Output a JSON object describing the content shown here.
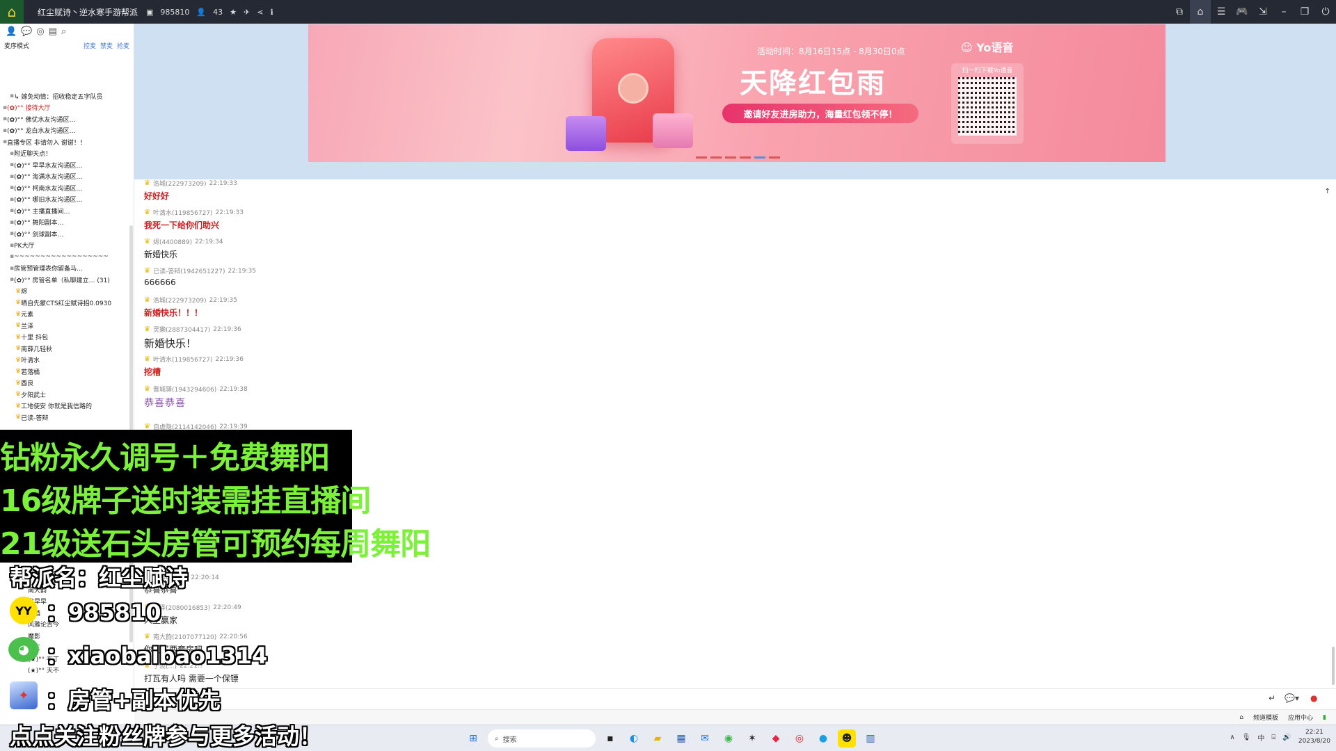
{
  "titlebar": {
    "title": "红尘赋诗丶逆水寒手游帮派",
    "channel_id": "985810",
    "user_count": "43"
  },
  "sidebar": {
    "mode": "麦序模式",
    "links": [
      "控麦",
      "禁麦",
      "抢麦"
    ],
    "tree": [
      "↳ 嫁免动情：招收稳定五字队员",
      "(✿)°° 接待大厅",
      "(✿)°° 佛优水友沟通区…",
      "(✿)°° 龙白水友沟通区…",
      "直播专区  非请勿入  谢谢！！",
      "附近聊天点！",
      "(✿)°° 早早水友沟通区…",
      "(✿)°° 淘满水友沟通区…",
      "(✿)°° 柯南水友沟通区…",
      "(✿)°° 哪旧水友沟通区…",
      "(✿)°° 主播直播间…",
      "(✿)°° 舞阳副本…",
      "(✿)°° 剑球副本…",
      "PK大厅",
      "~~~~~~~~~~~~~~~~~~",
      "房管预管理表你留备马…",
      "(✿)°° 房管名单（私聊建立…  (31)",
      "烬",
      "晒自先蒙CTS红尘赋诗招0.0930",
      "元素",
      "兰泽",
      "十里 抖包",
      "南薛几轻秋",
      "叶清水",
      "若落橘",
      "酉良",
      "夕阳武士",
      "工地使安  你就是我信路的",
      "已读-答辩"
    ],
    "tree_lower": [
      "南大韵",
      "龙早早",
      "早酒",
      "风雅论吉今",
      "魔影",
      "黯三",
      "(★)°° 布丁",
      "(★)°° 天不"
    ]
  },
  "banner": {
    "time": "活动时间：8月16日15点 - 8月30日0点",
    "headline": "天降红包雨",
    "slogan": "邀请好友进房助力，海量红包领不停！",
    "brand": "Yo语音",
    "qr_label": "扫一扫下载Yo语音"
  },
  "chat": [
    {
      "user": "浩城(222973209)",
      "time": "22:19:33",
      "text": "好好好",
      "style": "red"
    },
    {
      "user": "叶清水(119856727)",
      "time": "22:19:33",
      "text": "我死一下给你们助兴",
      "style": "red"
    },
    {
      "user": "烬(4400889)",
      "time": "22:19:34",
      "text": "新婚快乐",
      "style": "plain"
    },
    {
      "user": "已读-答辩(1942651227)",
      "time": "22:19:35",
      "text": "666666",
      "style": "plain"
    },
    {
      "user": "浩城(222973209)",
      "time": "22:19:35",
      "text": "新婚快乐！！！",
      "style": "red"
    },
    {
      "user": "灵獭(2887304417)",
      "time": "22:19:36",
      "text": "新婚快乐！",
      "style": "big"
    },
    {
      "user": "叶清水(119856727)",
      "time": "22:19:36",
      "text": "挖槽",
      "style": "red"
    },
    {
      "user": "晋城驿(1943294606)",
      "time": "22:19:38",
      "text": "恭喜恭喜",
      "style": "purple"
    },
    {
      "user": "自虐隐(2114142046)",
      "time": "22:19:39",
      "text": "",
      "style": "plain"
    },
    {
      "user": "(…382841)",
      "time": "22:20:14",
      "text": "恭喜恭喜",
      "style": "plain"
    },
    {
      "user": "兰泽(2080016853)",
      "time": "22:20:49",
      "text": "人生赢家",
      "style": "plain"
    },
    {
      "user": "南大韵(2107077120)",
      "time": "22:20:56",
      "text": "你们买两套房吧",
      "style": "plain"
    },
    {
      "user": "子规(…)",
      "time": "22:21:?",
      "text": "打瓦有人吗  需要一个保镖",
      "style": "plain"
    }
  ],
  "statusbar": {
    "items": [
      "频道模板",
      "应用中心"
    ]
  },
  "taskbar": {
    "search": "搜索",
    "time": "22:21",
    "date": "2023/8/20",
    "ime": "中"
  },
  "overlay": {
    "line1": "钻粉永久调号＋免费舞阳",
    "line2": "16级牌子送时装需挂直播间",
    "line3": "21级送石头房管可预约每周舞阳",
    "guild": "帮派名：红尘赋诗",
    "yy_logo": "YY",
    "yy": "：985810",
    "wechat": "：xiaobaibao1314",
    "role": "：房管+副本优先",
    "follow": "点点关注粉丝牌参与更多活动！"
  },
  "colors": {
    "overlay_green": "#7cf13a",
    "accent_red": "#d11e1e",
    "banner_pink": "#f9a2ae"
  }
}
